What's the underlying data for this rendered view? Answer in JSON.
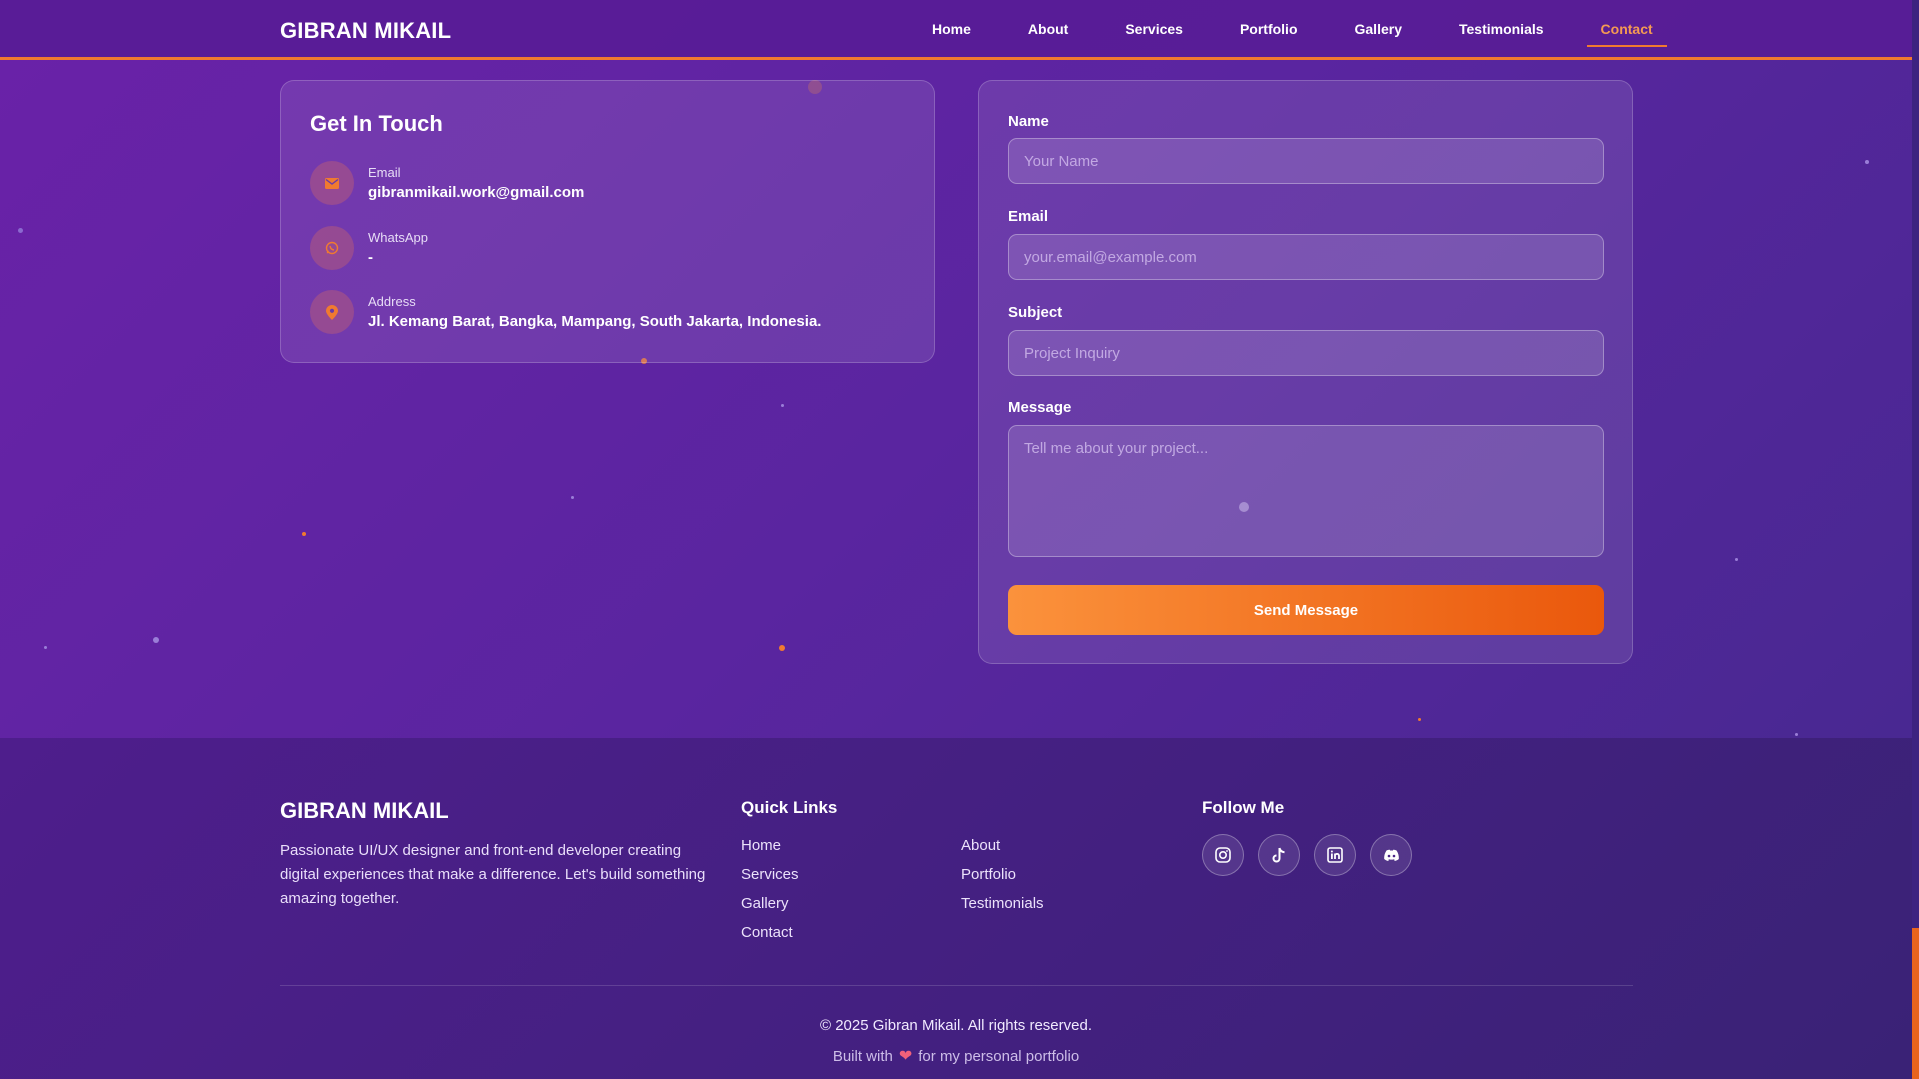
{
  "nav": {
    "brand": "GIBRAN MIKAIL",
    "links": [
      "Home",
      "About",
      "Services",
      "Portfolio",
      "Gallery",
      "Testimonials",
      "Contact"
    ],
    "active": "Contact"
  },
  "contact_info": {
    "title": "Get In Touch",
    "items": [
      {
        "label": "Email",
        "value": "gibranmikail.work@gmail.com",
        "icon": "envelope-icon"
      },
      {
        "label": "WhatsApp",
        "value": "-",
        "icon": "whatsapp-icon"
      },
      {
        "label": "Address",
        "value": "Jl. Kemang Barat, Bangka, Mampang, South Jakarta, Indonesia.",
        "icon": "map-pin-icon"
      }
    ]
  },
  "form": {
    "name_label": "Name",
    "name_placeholder": "Your Name",
    "email_label": "Email",
    "email_placeholder": "your.email@example.com",
    "subject_label": "Subject",
    "subject_placeholder": "Project Inquiry",
    "message_label": "Message",
    "message_placeholder": "Tell me about your project...",
    "submit_label": "Send Message"
  },
  "footer": {
    "brand": "GIBRAN MIKAIL",
    "description": "Passionate UI/UX designer and front-end developer creating digital experiences that make a difference. Let's build something amazing together.",
    "quick_links_title": "Quick Links",
    "quick_links_col1": [
      "Home",
      "Services",
      "Gallery",
      "Contact"
    ],
    "quick_links_col2": [
      "About",
      "Portfolio",
      "Testimonials"
    ],
    "follow_title": "Follow Me",
    "socials": [
      "instagram-icon",
      "tiktok-icon",
      "linkedin-icon",
      "discord-icon"
    ],
    "copyright": "© 2025 Gibran Mikail. All rights reserved.",
    "built_prefix": "Built with",
    "built_suffix": "for my personal portfolio"
  },
  "colors": {
    "accent": "#f07a30",
    "background_start": "#6a22a8",
    "background_end": "#44298e",
    "button_start": "#fb923c",
    "button_end": "#ea580c"
  }
}
